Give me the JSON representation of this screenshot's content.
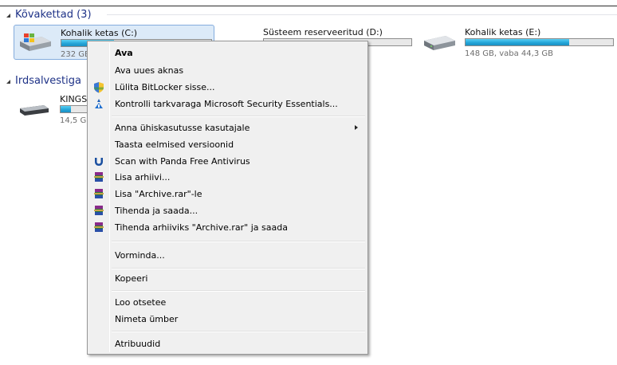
{
  "groups": {
    "hard_disks": {
      "title": "Kõvakettad (3)"
    },
    "removable": {
      "title": "Irdsalvestiga"
    }
  },
  "drives": {
    "c": {
      "name": "Kohalik ketas (C:)",
      "info": "232 GB",
      "used_fraction": 0.35
    },
    "d": {
      "name": "Süsteem reserveeritud (D:)",
      "info": "",
      "used_fraction": 0.0
    },
    "e": {
      "name": "Kohalik ketas (E:)",
      "info": "148 GB, vaba 44,3 GB",
      "used_fraction": 0.7
    },
    "usb": {
      "name": "KINGS",
      "info": "14,5 G",
      "used_fraction": 0.35
    }
  },
  "context_menu": {
    "open": "Ava",
    "open_new_window": "Ava uues aknas",
    "bitlocker": "Lülita BitLocker sisse...",
    "mse_scan": "Kontrolli tarkvaraga Microsoft Security Essentials...",
    "share": "Anna ühiskasutusse kasutajale",
    "restore_versions": "Taasta eelmised versioonid",
    "panda_scan": "Scan with Panda Free Antivirus",
    "add_archive": "Lisa arhiivi...",
    "add_archive_rar": "Lisa \"Archive.rar\"-le",
    "compress_email": "Tihenda ja saada...",
    "compress_rar_email": "Tihenda arhiiviks \"Archive.rar\" ja saada",
    "format": "Vorminda...",
    "copy": "Kopeeri",
    "create_shortcut": "Loo otsetee",
    "rename": "Nimeta ümber",
    "properties": "Atribuudid"
  },
  "colors": {
    "group_title": "#1e3287",
    "bar_fill": "#25a6d9",
    "selection": "#dceaf8"
  }
}
